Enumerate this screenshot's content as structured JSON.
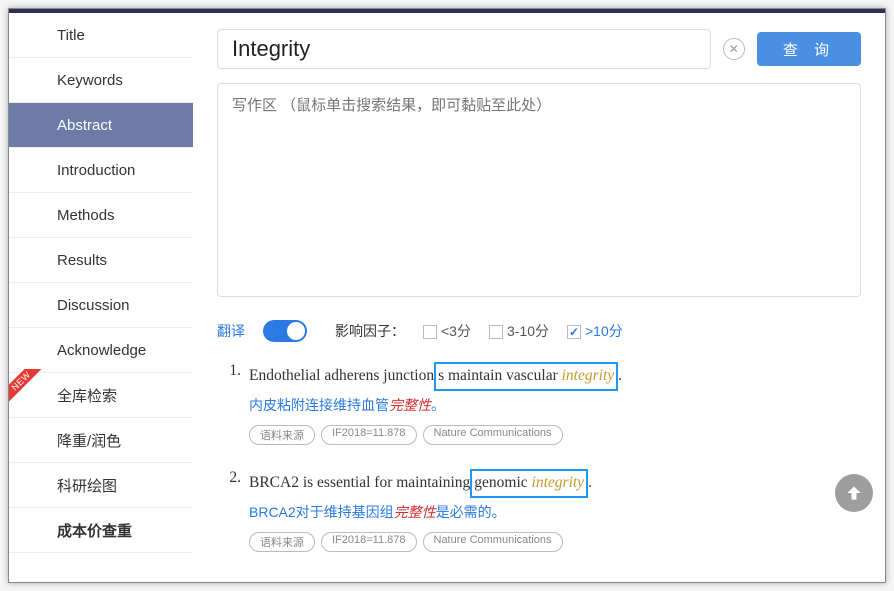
{
  "sidebar": {
    "items": [
      {
        "label": "Title"
      },
      {
        "label": "Keywords"
      },
      {
        "label": "Abstract"
      },
      {
        "label": "Introduction"
      },
      {
        "label": "Methods"
      },
      {
        "label": "Results"
      },
      {
        "label": "Discussion"
      },
      {
        "label": "Acknowledge"
      },
      {
        "label": "全库检索"
      },
      {
        "label": "降重/润色"
      },
      {
        "label": "科研绘图"
      },
      {
        "label": "成本价查重"
      }
    ],
    "new_badge": "NEW"
  },
  "search": {
    "value": "Integrity",
    "query_btn": "查 询"
  },
  "writearea_placeholder": "写作区 （鼠标单击搜索结果，即可黏贴至此处）",
  "filters": {
    "translate_label": "翻译",
    "if_label": "影响因子：",
    "options": [
      "<3分",
      "3-10分",
      ">10分"
    ]
  },
  "results": [
    {
      "num": "1.",
      "en_pre": "Endothelial adherens junction",
      "en_box": "s maintain vascular ",
      "en_kw": "integrity",
      "en_post": ".",
      "zh_pre": "内皮粘附连接维持血管",
      "zh_red": "完整性",
      "zh_post": "。",
      "tags": [
        "语料来源",
        "IF2018=11.878",
        "Nature Communications"
      ]
    },
    {
      "num": "2.",
      "en_pre": "BRCA2 is essential for maintaining",
      "en_box": " genomic ",
      "en_kw": "integrity",
      "en_post": ".",
      "zh_pre": "BRCA2对于维持基因组",
      "zh_red": "完整性",
      "zh_post": "是必需的。",
      "tags": [
        "语料来源",
        "IF2018=11.878",
        "Nature Communications"
      ]
    }
  ]
}
